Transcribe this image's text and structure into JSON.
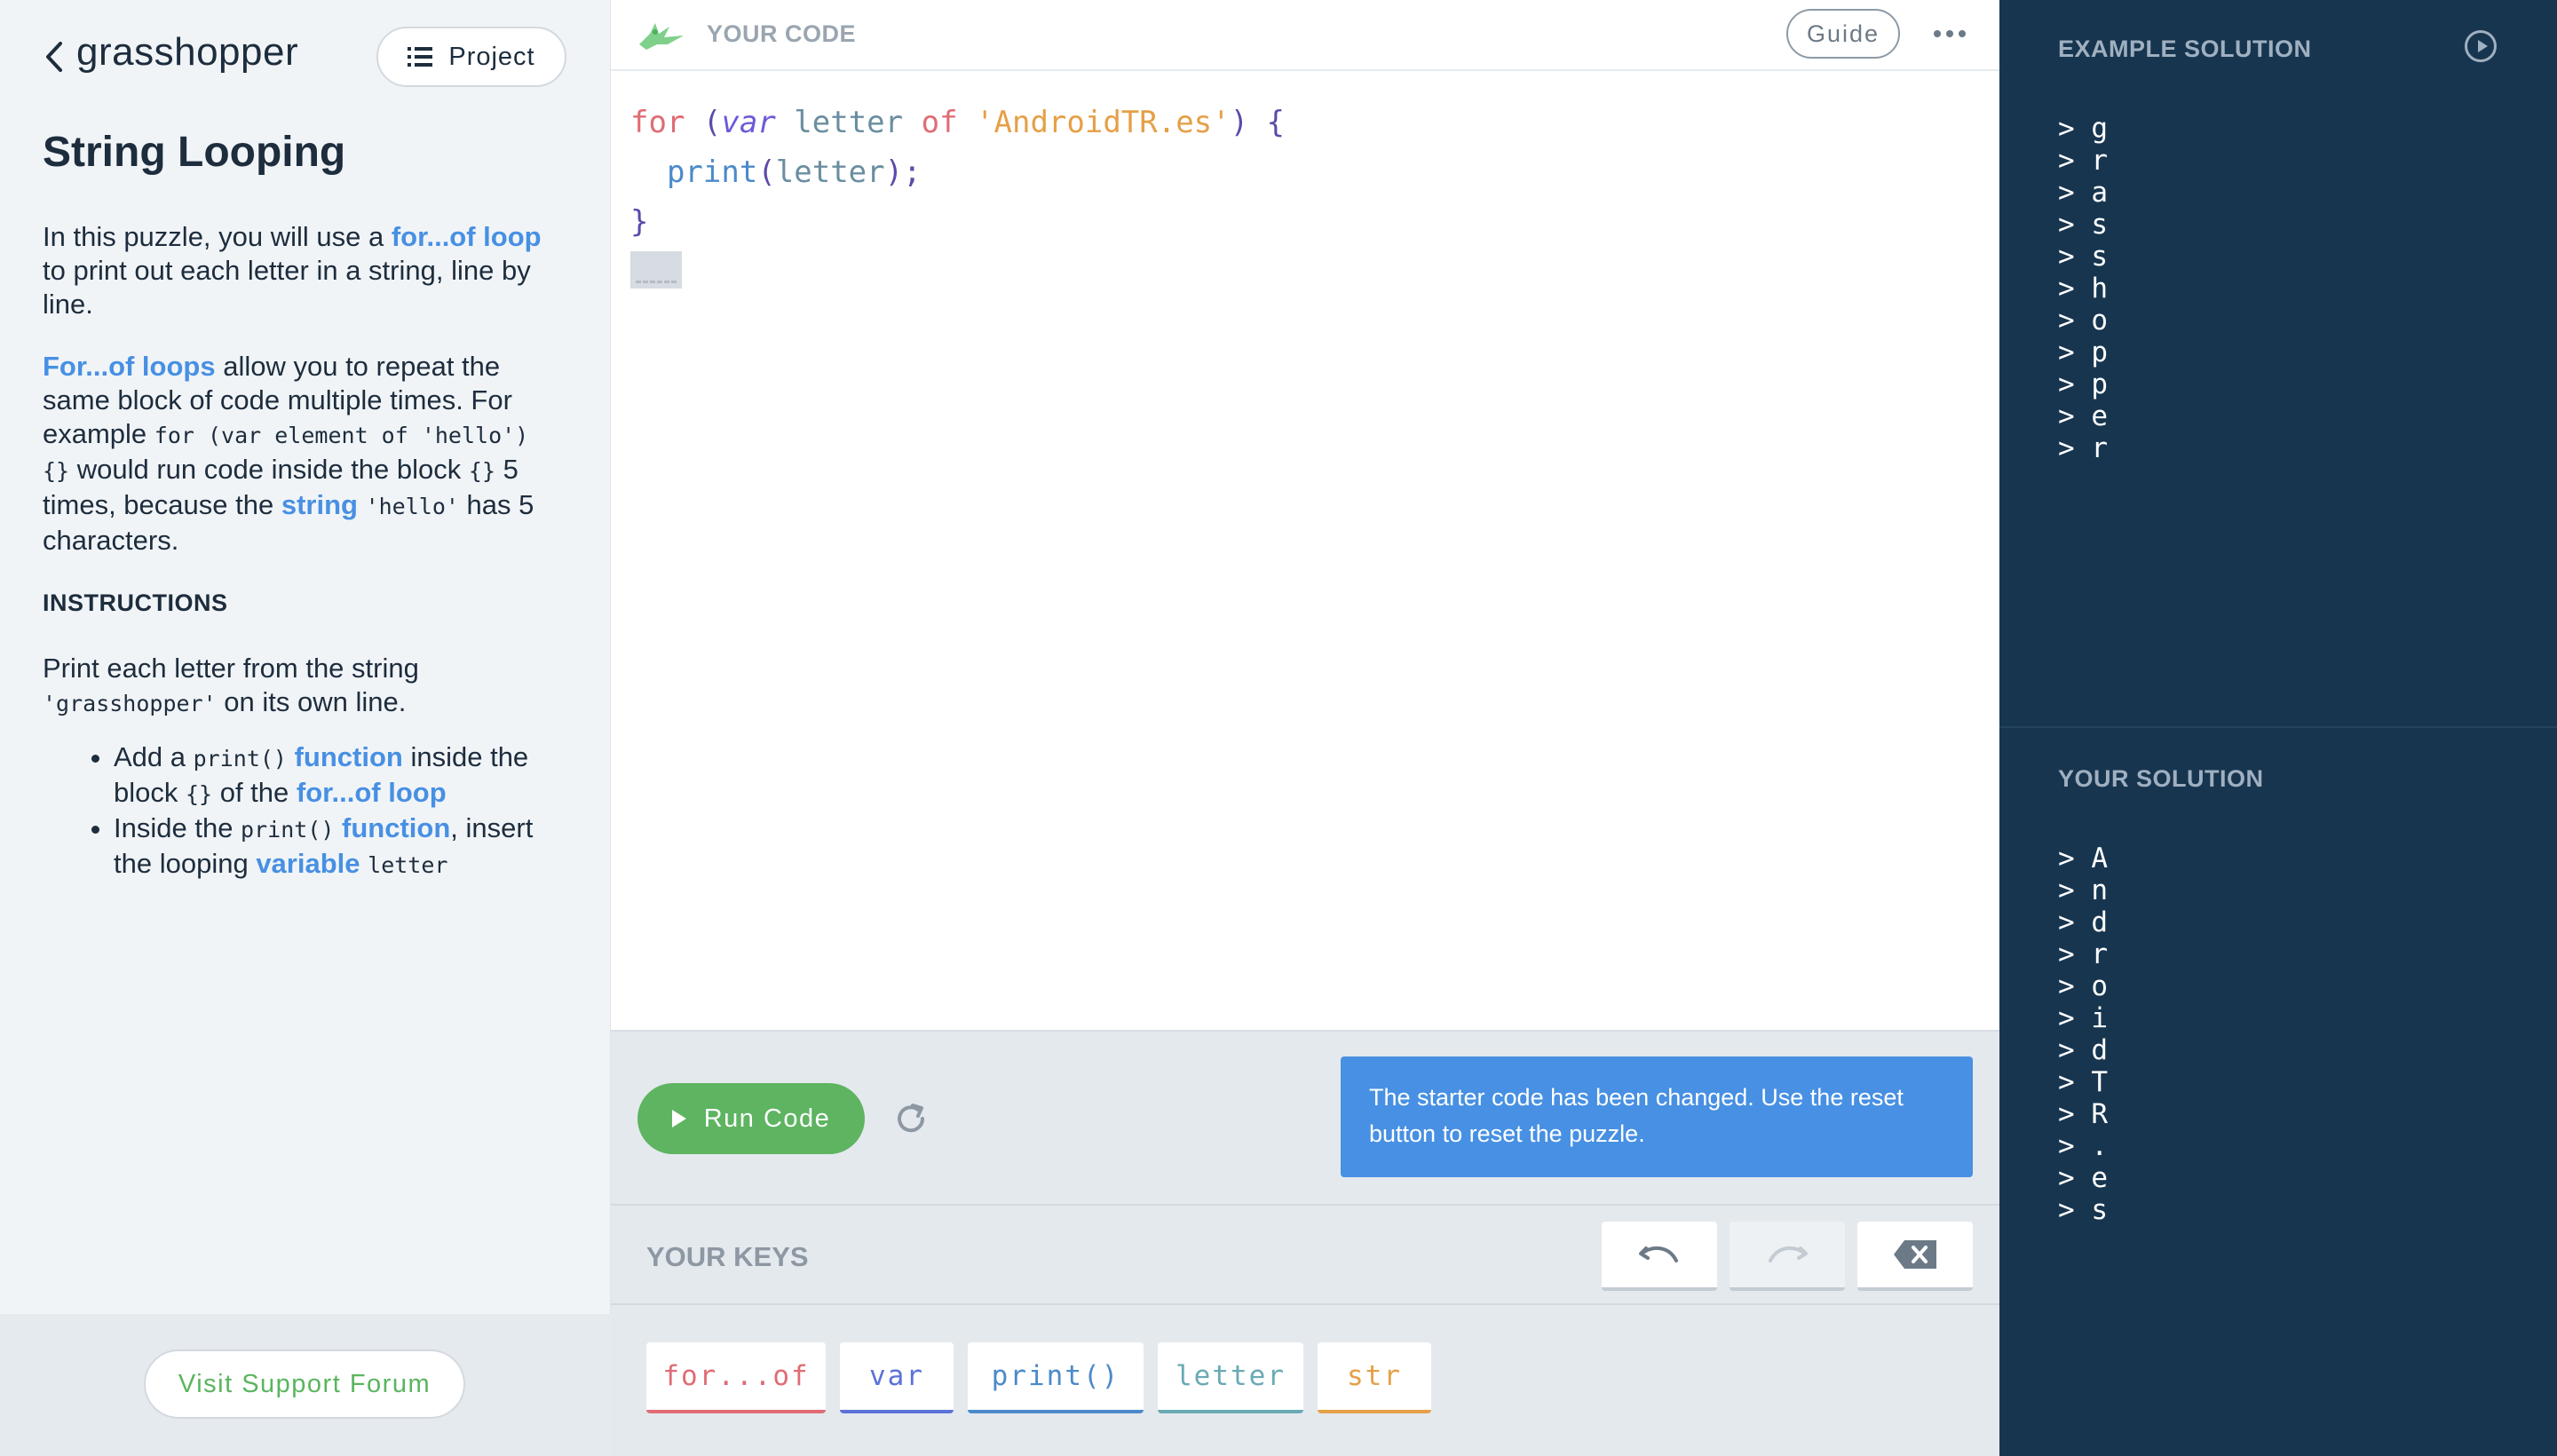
{
  "left": {
    "logo": "grasshopper",
    "project_label": "Project",
    "title": "String Looping",
    "p1": {
      "a": "In this puzzle, you will use a ",
      "kw": "for...of loop",
      "b": " to print out each letter in a string, line by line."
    },
    "p2": {
      "kw1": "For...of loops",
      "a": " allow you to repeat the same block of code multiple times. For example ",
      "code1": "for (var element of 'hello') {}",
      "b": " would run code inside the block ",
      "code2": "{}",
      "c": " 5 times, because the ",
      "kw2": "string",
      "d": " ",
      "code3": "'hello'",
      "e": " has 5 characters."
    },
    "instructions_label": "INSTRUCTIONS",
    "p3": {
      "a": "Print each letter from the string ",
      "code": "'grasshopper'",
      "b": " on its own line."
    },
    "bullet1": {
      "a": "Add a ",
      "code1": "print()",
      "kw1": "function",
      "b": " inside the block ",
      "code2": "{}",
      "c": " of the ",
      "kw2": "for...of loop"
    },
    "bullet2": {
      "a": "Inside the ",
      "code1": "print()",
      "kw1": "function",
      "b": ", insert the looping ",
      "kw2": "variable",
      "c": " ",
      "code2": "letter"
    },
    "forum_label": "Visit Support Forum"
  },
  "editor": {
    "header_title": "YOUR CODE",
    "guide_label": "Guide",
    "line1": {
      "for": "for",
      "open": " (",
      "var": "var",
      "sp1": " ",
      "id": "letter",
      "sp2": " ",
      "of": "of",
      "sp3": " ",
      "str": "'AndroidTR.es'",
      "close": ") {"
    },
    "line2": {
      "indent": "  ",
      "fn": "print",
      "open": "(",
      "id": "letter",
      "close": ");"
    },
    "line3": "}"
  },
  "run": {
    "label": "Run Code",
    "notice": "The starter code has been changed. Use the reset button to reset the puzzle."
  },
  "keys": {
    "title": "YOUR KEYS",
    "items": [
      "for...of",
      "var",
      "print()",
      "letter",
      "str"
    ]
  },
  "example_solution": {
    "title": "EXAMPLE SOLUTION",
    "lines": [
      "> g",
      "> r",
      "> a",
      "> s",
      "> s",
      "> h",
      "> o",
      "> p",
      "> p",
      "> e",
      "> r"
    ]
  },
  "your_solution": {
    "title": "YOUR SOLUTION",
    "lines": [
      "> A",
      "> n",
      "> d",
      "> r",
      "> o",
      "> i",
      "> d",
      "> T",
      "> R",
      "> .",
      "> e",
      "> s"
    ]
  },
  "colors": {
    "accent_blue": "#4790e3",
    "run_green": "#5eb461",
    "dark_navy": "#17354f"
  }
}
